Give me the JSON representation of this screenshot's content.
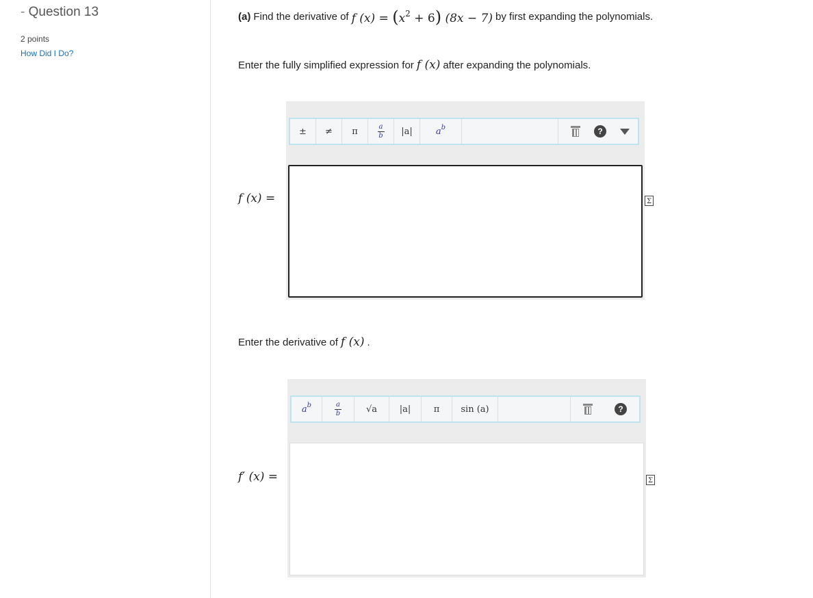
{
  "sidebar": {
    "dash": "-",
    "question_title": "Question 13",
    "points": "2 points",
    "how_did_i_do": "How Did I Do?"
  },
  "prompt_a": {
    "part": "(a)",
    "text_before": "Find the derivative of",
    "expr_lhs": "f (x) =",
    "expr_open": "(",
    "expr_x": "x",
    "expr_exp": "2",
    "expr_plus6": "+ 6",
    "expr_close": ")",
    "expr_second": "(8x − 7)",
    "text_after": "by first expanding the polynomials."
  },
  "prompt_b": {
    "text_before": "Enter the fully simplified expression for",
    "expr": "f (x)",
    "text_after": "after expanding the polynomials."
  },
  "prompt_c": {
    "text_before": "Enter the derivative of",
    "expr": "f (x)",
    "text_after": "."
  },
  "editor1": {
    "label": "f (x) =",
    "toolbar": {
      "plus_minus": "±",
      "not_equal": "≠",
      "pi": "π",
      "frac_num": "a",
      "frac_den": "b",
      "abs": "|a|",
      "pow_base": "a",
      "pow_exp": "b"
    },
    "value": ""
  },
  "editor2": {
    "label": "f′ (x) =",
    "toolbar": {
      "pow_base": "a",
      "pow_exp": "b",
      "frac_num": "a",
      "frac_den": "b",
      "sqrt": "√a",
      "abs": "|a|",
      "pi": "π",
      "sin": "sin (a)"
    },
    "value": ""
  },
  "icons": {
    "help": "?",
    "sigma": "Σ"
  }
}
